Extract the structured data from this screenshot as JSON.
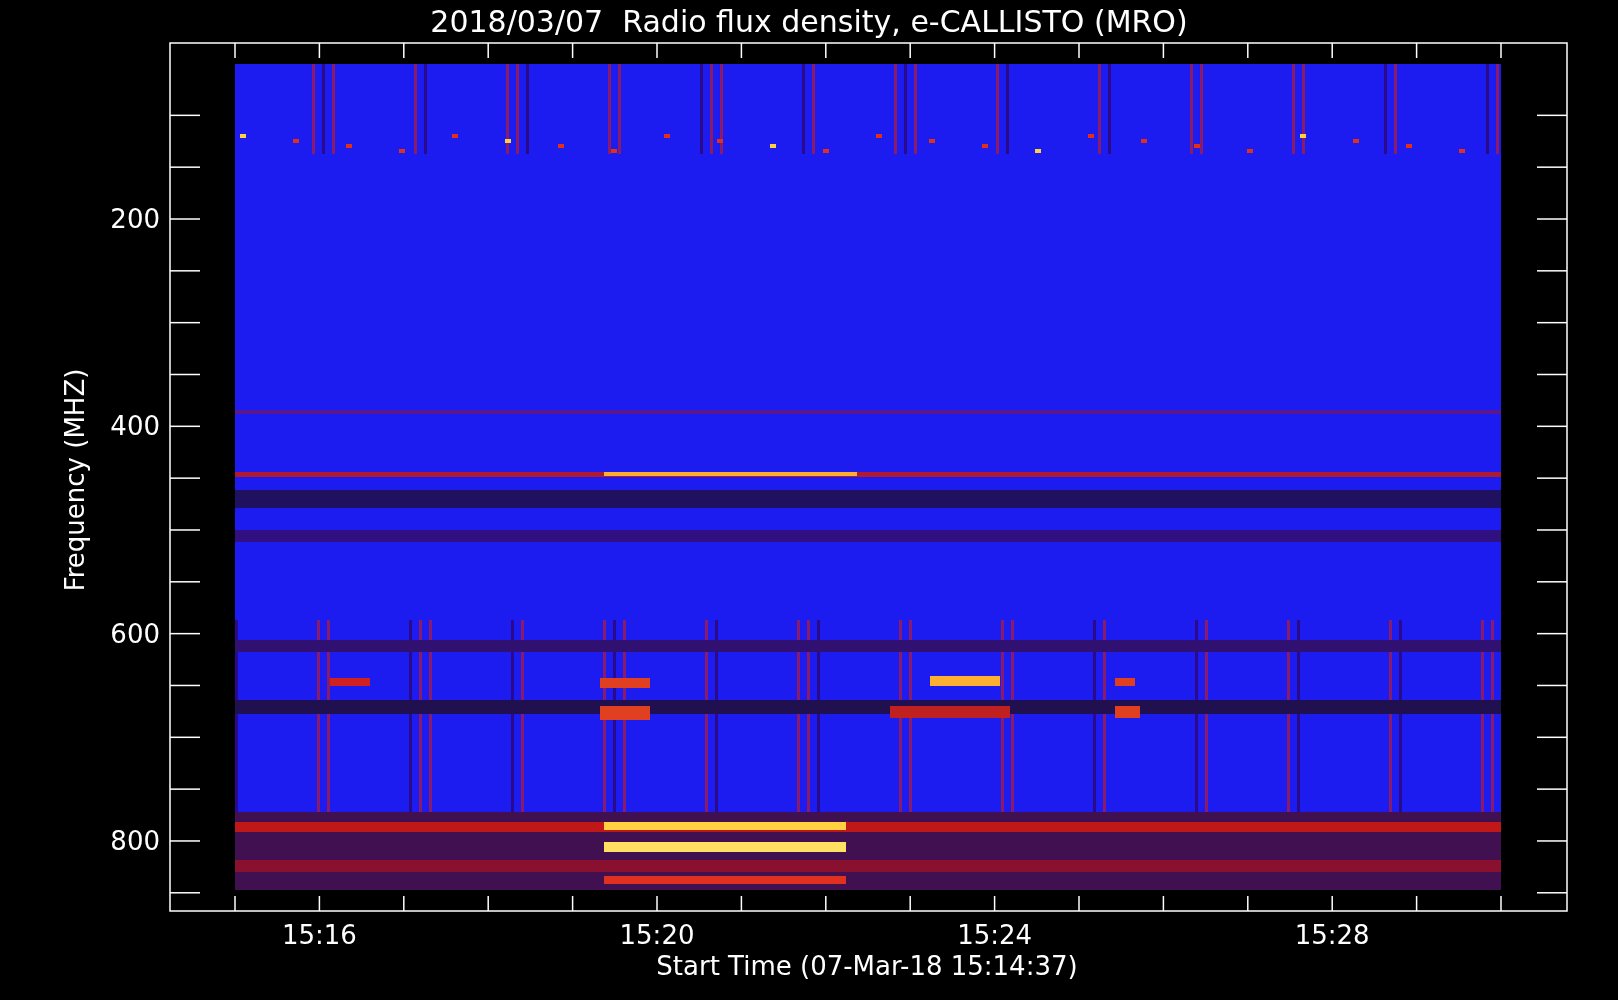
{
  "title": "2018/03/07  Radio flux density, e-CALLISTO (MRO)",
  "plot": {
    "ylabel": "Frequency (MHZ)",
    "yticks": [
      "200",
      "400",
      "600",
      "800"
    ],
    "xlabel": "Start Time (07-Mar-18 15:14:37)",
    "xticks": [
      "15:16",
      "15:20",
      "15:24",
      "15:28"
    ]
  }
}
